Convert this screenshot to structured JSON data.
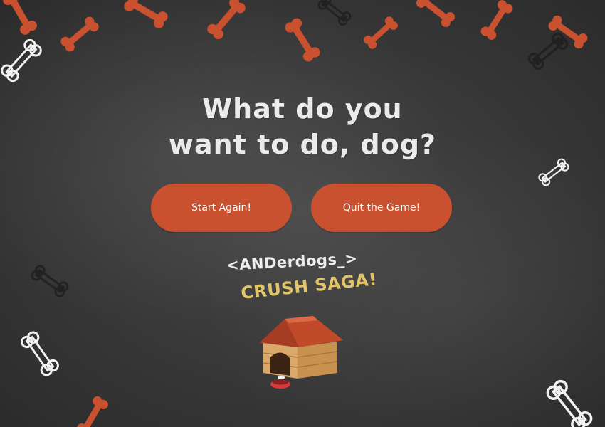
{
  "dialog": {
    "title_line1": "What do you",
    "title_line2": "want to do, dog?"
  },
  "buttons": {
    "start_label": "Start Again!",
    "quit_label": "Quit the Game!"
  },
  "logo": {
    "line1": "<ANDerdogs_>",
    "line2": "CRUSH SAGA!"
  },
  "colors": {
    "accent": "#c9512f",
    "background": "#3a3a3a",
    "title_text": "#ebebeb",
    "logo_yellow": "#e3c569"
  },
  "icons": {
    "decorations": "bone-icon",
    "mascot": "doghouse-icon"
  }
}
